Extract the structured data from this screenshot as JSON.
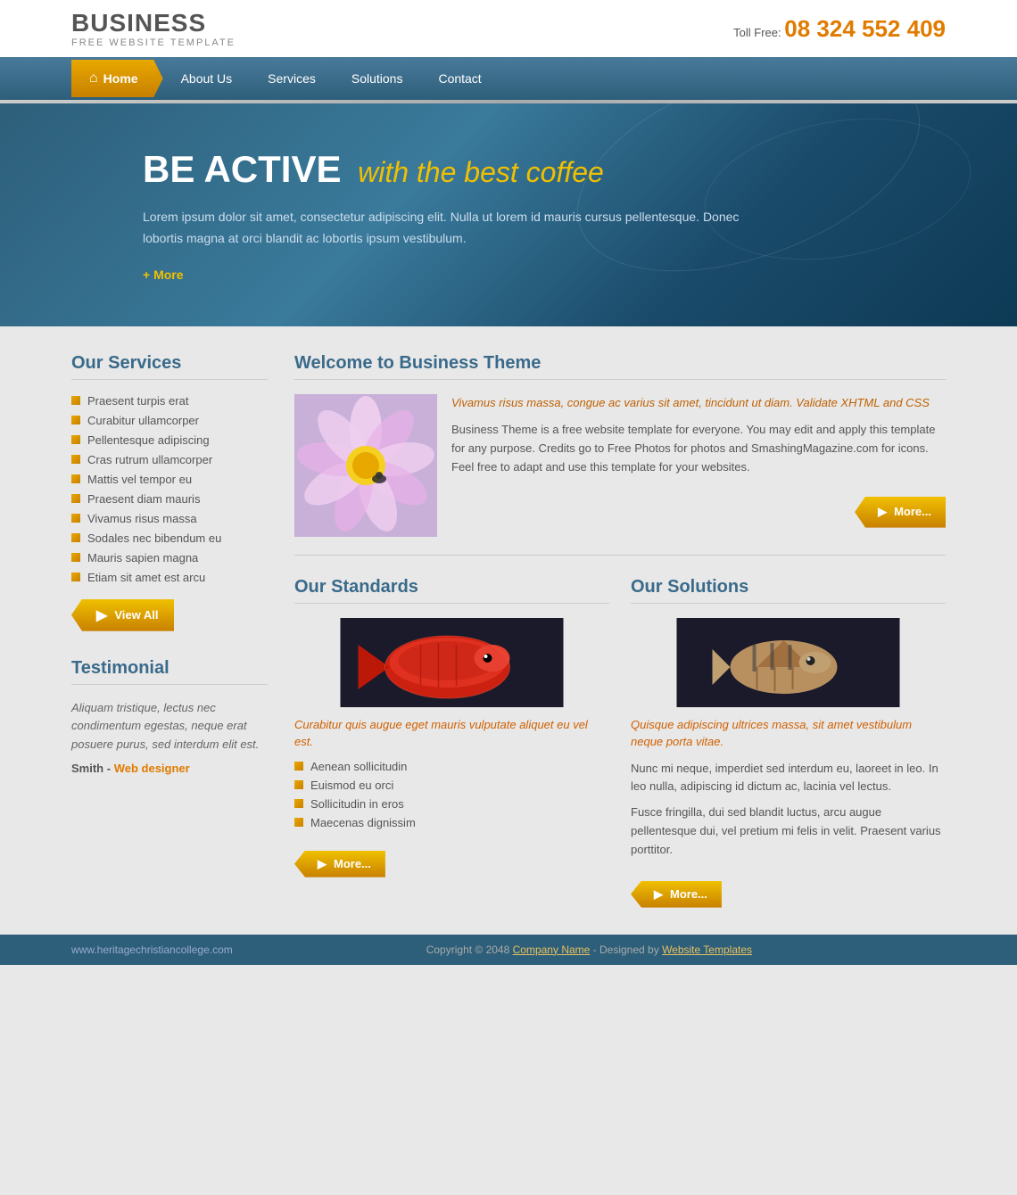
{
  "header": {
    "logo_title": "BUSINESS",
    "logo_sub": "FREE WEBSITE TEMPLATE",
    "phone_label": "Toll Free:",
    "phone_number": "08 324 552 409"
  },
  "nav": {
    "home": "Home",
    "about": "About Us",
    "services": "Services",
    "solutions": "Solutions",
    "contact": "Contact"
  },
  "hero": {
    "title_white": "BE ACTIVE",
    "title_gold": "with the best coffee",
    "description": "Lorem ipsum dolor sit amet, consectetur adipiscing elit. Nulla ut lorem id mauris cursus pellentesque. Donec lobortis magna at orci blandit ac lobortis ipsum vestibulum.",
    "more_link": "+ More"
  },
  "sidebar": {
    "services_title": "Our Services",
    "services_items": [
      "Praesent turpis erat",
      "Curabitur ullamcorper",
      "Pellentesque adipiscing",
      "Cras rutrum ullamcorper",
      "Mattis vel tempor eu",
      "Praesent diam mauris",
      "Vivamus risus massa",
      "Sodales nec bibendum eu",
      "Mauris sapien magna",
      "Etiam sit amet est arcu"
    ],
    "view_all_btn": "View All",
    "testimonial_title": "Testimonial",
    "testimonial_text": "Aliquam tristique, lectus nec condimentum egestas, neque erat posuere purus, sed interdum elit est.",
    "testimonial_author": "Smith",
    "testimonial_role": "Web designer"
  },
  "welcome": {
    "title": "Welcome to Business Theme",
    "highlight": "Vivamus risus massa, congue ac varius sit amet, tincidunt ut diam. Validate XHTML and CSS",
    "body": "Business Theme is a free website template for everyone. You may edit and apply this template for any purpose. Credits go to Free Photos for photos and SmashingMagazine.com for icons. Feel free to adapt and use this template for your websites.",
    "more_btn": "More..."
  },
  "standards": {
    "title": "Our Standards",
    "caption": "Curabitur quis augue eget mauris vulputate aliquet eu vel est.",
    "items": [
      "Aenean sollicitudin",
      "Euismod eu orci",
      "Sollicitudin in eros",
      "Maecenas dignissim"
    ],
    "more_btn": "More..."
  },
  "solutions": {
    "title": "Our Solutions",
    "caption": "Quisque adipiscing ultrices massa, sit amet vestibulum neque porta vitae.",
    "body1": "Nunc mi neque, imperdiet sed interdum eu, laoreet in leo. In leo nulla, adipiscing id dictum ac, lacinia vel lectus.",
    "body2": "Fusce fringilla, dui sed blandit luctus, arcu augue pellentesque dui, vel pretium mi felis in velit. Praesent varius porttitor.",
    "more_btn": "More..."
  },
  "footer": {
    "url": "www.heritagechristiancollege.com",
    "copyright": "Copyright © 2048",
    "company_link": "Company Name",
    "designed_by": "- Designed by",
    "templates_link": "Website Templates"
  }
}
